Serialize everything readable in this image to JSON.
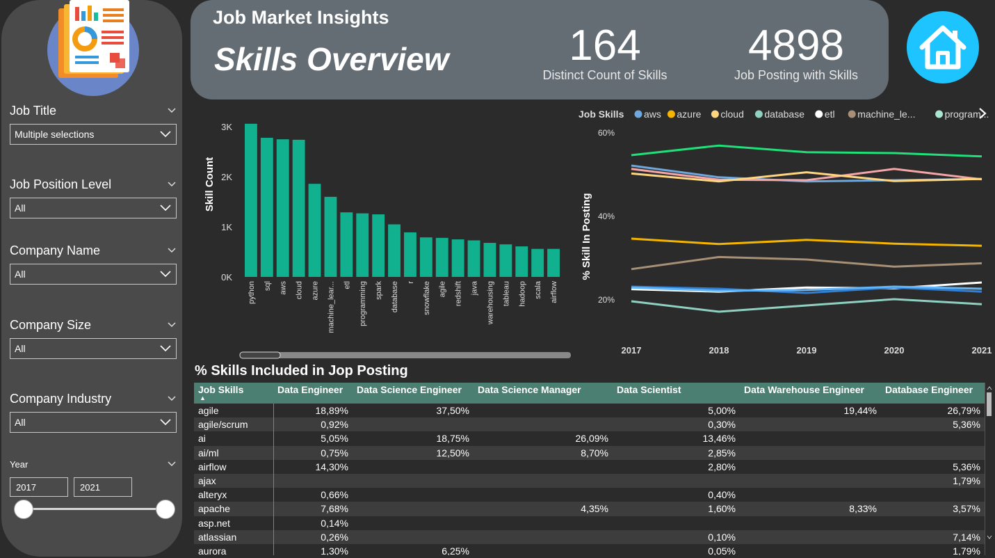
{
  "sidebar": {
    "slicers": [
      {
        "title": "Job Title",
        "value": "Multiple selections"
      },
      {
        "title": "Job Position Level",
        "value": "All"
      },
      {
        "title": "Company Name",
        "value": "All"
      },
      {
        "title": "Company Size",
        "value": "All"
      },
      {
        "title": "Company Industry",
        "value": "All"
      }
    ],
    "year": {
      "title": "Year",
      "from": "2017",
      "to": "2021"
    }
  },
  "header": {
    "title": "Job Market Insights",
    "subtitle": "Skills Overview",
    "kpi1": {
      "value": "164",
      "label": "Distinct Count of Skills"
    },
    "kpi2": {
      "value": "4898",
      "label": "Job Posting with Skills"
    }
  },
  "colors": {
    "bar": "#11b08f",
    "header": "#646c74",
    "table_header": "#4b7f72",
    "home": "#1ec4ff"
  },
  "icons": {
    "logo": "report-logo-icon",
    "home": "home-icon"
  },
  "chart_data": [
    {
      "type": "bar",
      "ylabel": "Skill Count",
      "xlabel": "",
      "ylim": [
        0,
        3100
      ],
      "yticks": [
        {
          "v": 0,
          "label": "0K"
        },
        {
          "v": 1000,
          "label": "1K"
        },
        {
          "v": 2000,
          "label": "2K"
        },
        {
          "v": 3000,
          "label": "3K"
        }
      ],
      "categories": [
        "python",
        "sql",
        "aws",
        "cloud",
        "azure",
        "machine_lear...",
        "etl",
        "programming",
        "spark",
        "database",
        "r",
        "snowflake",
        "agile",
        "redshift",
        "java",
        "warehousing",
        "tableau",
        "hadoop",
        "scala",
        "airflow"
      ],
      "values": [
        3060,
        2780,
        2750,
        2740,
        1860,
        1600,
        1290,
        1270,
        1250,
        1050,
        890,
        790,
        780,
        750,
        730,
        680,
        650,
        610,
        560,
        560
      ]
    },
    {
      "type": "line",
      "ylabel": "% Skill In Posting",
      "legend_title": "Job Skills",
      "legend_position": "top",
      "x": [
        2017,
        2018,
        2019,
        2020,
        2021
      ],
      "ylim": [
        15,
        62
      ],
      "yticks": [
        {
          "v": 20,
          "label": "20%"
        },
        {
          "v": 40,
          "label": "40%"
        },
        {
          "v": 60,
          "label": "60%"
        }
      ],
      "legend": [
        {
          "name": "aws",
          "color": "#6fa8dc"
        },
        {
          "name": "azure",
          "color": "#f4b400"
        },
        {
          "name": "cloud",
          "color": "#ffd580"
        },
        {
          "name": "database",
          "color": "#8fd1c0"
        },
        {
          "name": "etl",
          "color": "#ffffff"
        },
        {
          "name": "machine_le...",
          "color": "#a89077"
        },
        {
          "name": "program...",
          "color": "#a8e6cf"
        }
      ],
      "series": [
        {
          "name": "",
          "color": "#1fe07a",
          "values": [
            54.5,
            56.8,
            55.2,
            55.0,
            54.2
          ]
        },
        {
          "name": "",
          "color": "#6fa8dc",
          "values": [
            52.0,
            49.2,
            48.2,
            48.5,
            48.8
          ]
        },
        {
          "name": "",
          "color": "#f4a6a6",
          "values": [
            51.2,
            48.6,
            48.5,
            51.2,
            48.7
          ]
        },
        {
          "name": "",
          "color": "#ffd580",
          "values": [
            50.1,
            48.2,
            50.4,
            48.3,
            48.8
          ]
        },
        {
          "name": "",
          "color": "#f4b400",
          "values": [
            34.5,
            33.2,
            34.2,
            33.3,
            32.8
          ]
        },
        {
          "name": "",
          "color": "#a89077",
          "values": [
            27.2,
            30.1,
            29.5,
            27.8,
            28.6
          ]
        },
        {
          "name": "",
          "color": "#ffffff",
          "values": [
            22.4,
            21.8,
            22.8,
            22.6,
            24.0
          ]
        },
        {
          "name": "",
          "color": "#2f7fd6",
          "values": [
            23.0,
            22.5,
            21.5,
            22.8,
            21.8
          ]
        },
        {
          "name": "",
          "color": "#64b5f6",
          "values": [
            22.8,
            22.0,
            22.2,
            23.0,
            22.5
          ]
        },
        {
          "name": "",
          "color": "#8fd1c0",
          "values": [
            19.5,
            17.0,
            18.5,
            20.0,
            18.8
          ]
        }
      ]
    }
  ],
  "table": {
    "title": "% Skills Included in Jop Posting",
    "columns": [
      "Job Skills",
      "Data Engineer",
      "Data Science Engineer",
      "Data Science Manager",
      "Data Scientist",
      "Data Warehouse Engineer",
      "Database Engineer"
    ],
    "rows": [
      [
        "agile",
        "18,89%",
        "37,50%",
        "",
        "5,00%",
        "19,44%",
        "26,79%"
      ],
      [
        "agile/scrum",
        "0,92%",
        "",
        "",
        "0,30%",
        "",
        "5,36%"
      ],
      [
        "ai",
        "5,05%",
        "18,75%",
        "26,09%",
        "13,46%",
        "",
        ""
      ],
      [
        "ai/ml",
        "0,75%",
        "12,50%",
        "8,70%",
        "2,85%",
        "",
        ""
      ],
      [
        "airflow",
        "14,30%",
        "",
        "",
        "2,80%",
        "",
        "5,36%"
      ],
      [
        "ajax",
        "",
        "",
        "",
        "",
        "",
        "1,79%"
      ],
      [
        "alteryx",
        "0,66%",
        "",
        "",
        "0,40%",
        "",
        ""
      ],
      [
        "apache",
        "7,68%",
        "",
        "4,35%",
        "1,60%",
        "8,33%",
        "3,57%"
      ],
      [
        "asp.net",
        "0,14%",
        "",
        "",
        "",
        "",
        ""
      ],
      [
        "atlassian",
        "0,26%",
        "",
        "",
        "0,10%",
        "",
        "7,14%"
      ],
      [
        "aurora",
        "1,30%",
        "6,25%",
        "",
        "0,05%",
        "",
        "1,79%"
      ]
    ]
  }
}
